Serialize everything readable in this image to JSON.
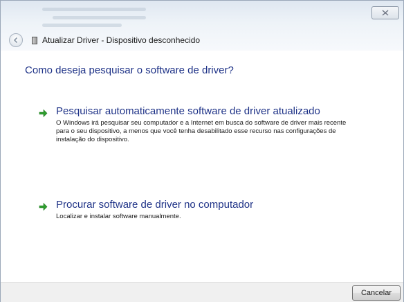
{
  "window": {
    "title": "Atualizar Driver - Dispositivo desconhecido",
    "close_icon": "close-icon",
    "back_icon": "back-arrow-icon",
    "device_icon": "device-icon"
  },
  "content": {
    "question": "Como deseja pesquisar o software de driver?",
    "options": [
      {
        "icon": "green-arrow-icon",
        "title": "Pesquisar automaticamente software de driver atualizado",
        "description": "O Windows irá pesquisar seu computador e a Internet em busca do software de driver mais recente para o seu dispositivo, a menos que você tenha desabilitado esse recurso nas configurações de instalação do dispositivo."
      },
      {
        "icon": "green-arrow-icon",
        "title": "Procurar software de driver no computador",
        "description": "Localizar e instalar software manualmente."
      }
    ]
  },
  "footer": {
    "cancel_label": "Cancelar"
  },
  "colors": {
    "link_blue": "#1e3287",
    "arrow_green": "#2f9e2f",
    "footer_bg": "#f0f0f0"
  }
}
